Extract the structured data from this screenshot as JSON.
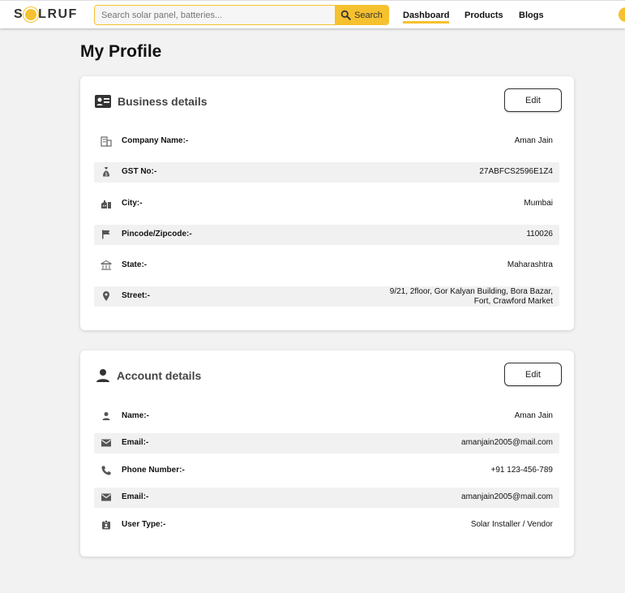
{
  "header": {
    "logo_text_1": "S",
    "logo_text_2": "LRUF",
    "search_placeholder": "Search solar panel, batteries...",
    "search_button": "Search",
    "nav": [
      "Dashboard",
      "Products",
      "Blogs"
    ]
  },
  "page_title": "My Profile",
  "business": {
    "title": "Business details",
    "edit": "Edit",
    "rows": [
      {
        "label": "Company Name:-",
        "value": "Aman Jain",
        "icon": "building-icon"
      },
      {
        "label": "GST No:-",
        "value": "27ABFCS2596E1Z4",
        "icon": "money-bag-icon"
      },
      {
        "label": "City:-",
        "value": "Mumbai",
        "icon": "city-icon"
      },
      {
        "label": "Pincode/Zipcode:-",
        "value": "110026",
        "icon": "flag-icon"
      },
      {
        "label": "State:-",
        "value": "Maharashtra",
        "icon": "bank-icon"
      },
      {
        "label": "Street:-",
        "value_line1": "9/21, 2floor, Gor Kalyan Building, Bora Bazar,",
        "value_line2": "Fort, Crawford Market",
        "icon": "location-pin-icon"
      }
    ]
  },
  "account": {
    "title": "Account details",
    "edit": "Edit",
    "rows": [
      {
        "label": "Name:-",
        "value": "Aman Jain",
        "icon": "person-icon"
      },
      {
        "label": "Email:-",
        "value": "amanjain2005@mail.com",
        "icon": "mail-icon"
      },
      {
        "label": "Phone Number:-",
        "value": "+91 123-456-789",
        "icon": "phone-icon"
      },
      {
        "label": "Email:-",
        "value": "amanjain2005@mail.com",
        "icon": "mail-icon"
      },
      {
        "label": "User Type:-",
        "value": "Solar Installer / Vendor",
        "icon": "badge-icon"
      }
    ]
  },
  "colors": {
    "accent": "#f6c12f",
    "row_shade": "#f1f1f1"
  }
}
